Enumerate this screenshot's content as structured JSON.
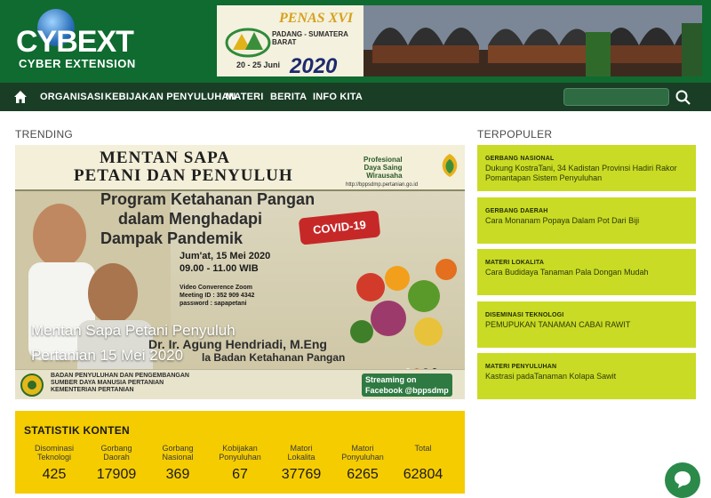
{
  "site": {
    "logo_word": "CYBEXT",
    "logo_sub": "CYBER EXTENSION"
  },
  "banner": {
    "title": "PENAS XVI",
    "place": "PADANG - SUMATERA BARAT",
    "dates": "20 - 25 Juni",
    "year": "2020"
  },
  "nav": {
    "items": [
      "ORGANISASI",
      "KEBIJAKAN PENYULUHAN",
      "MATERI",
      "BERITA",
      "INFO KITA"
    ],
    "search_placeholder": ""
  },
  "sections": {
    "trending": "TRENDING",
    "terpopuler": "TERPOPULER",
    "statistik": "STATISTIK KONTEN"
  },
  "trending": {
    "poster_line1": "MENTAN SAPA",
    "poster_line2": "PETANI DAN PENYULUH",
    "brand": "Profesional\nDaya Saing\nWirausaha",
    "url": "http://bppsdmp.pertanian.go.id",
    "program1": "Program Ketahanan Pangan",
    "program2": "dalam Menghadapi",
    "program3": "Dampak Pandemik",
    "covid": "COVID-19",
    "date_line": "Jum'at, 15 Mei 2020",
    "time_line": "09.00 - 11.00 WIB",
    "zoom1": "Video Converence Zoom",
    "zoom2": "Meeting ID : 352 909 4342",
    "zoom3": "password : sapapetani",
    "speaker": "Dr. Ir. Agung Hendriadi, M.Eng",
    "speaker_role": "la Badan Ketahanan Pangan",
    "ministry1": "BADAN PENYULUHAN DAN PENGEMBANGAN",
    "ministry2": "SUMBER DAYA MANUSIA PERTANIAN",
    "ministry3": "KEMENTERIAN PERTANIAN",
    "stream": "Streaming on",
    "facebook": "Facebook @bppsdmp",
    "caption1": "Mentan Sapa Petani Penyuluh",
    "caption2": "Pertanian 15 Mei 2020"
  },
  "popular": [
    {
      "category": "GERBANG NASIONAL",
      "title": "Dukung KostraTani, 34 Kadistan Provinsi Hadiri Rakor Pomantapan Sistem Penyuluhan"
    },
    {
      "category": "GERBANG DAERAH",
      "title": "Cara Monanam Popaya Dalam Pot Dari Biji"
    },
    {
      "category": "MATERI LOKALITA",
      "title": "Cara Budidaya Tanaman Pala Dongan Mudah"
    },
    {
      "category": "DISEMINASI TEKNOLOGI",
      "title": "PEMUPUKAN TANAMAN CABAI RAWIT"
    },
    {
      "category": "MATERI PENYULUHAN",
      "title": "Kastrasi padaTanaman Kolapa Sawit"
    }
  ],
  "stats": [
    {
      "label": "Disominasi\nTeknologi",
      "value": "425"
    },
    {
      "label": "Gorbang\nDaorah",
      "value": "17909"
    },
    {
      "label": "Gorbang\nNasional",
      "value": "369"
    },
    {
      "label": "Kobijakan\nPonyuluhan",
      "value": "67"
    },
    {
      "label": "Matori\nLokalita",
      "value": "37769"
    },
    {
      "label": "Matori\nPonyuluhan",
      "value": "6265"
    },
    {
      "label": "Total",
      "value": "62804"
    }
  ],
  "colors": {
    "header": "#0f6b2f",
    "nav": "#1a3d26",
    "popular_card": "#c9db24",
    "stats_bg": "#f5cc00"
  }
}
